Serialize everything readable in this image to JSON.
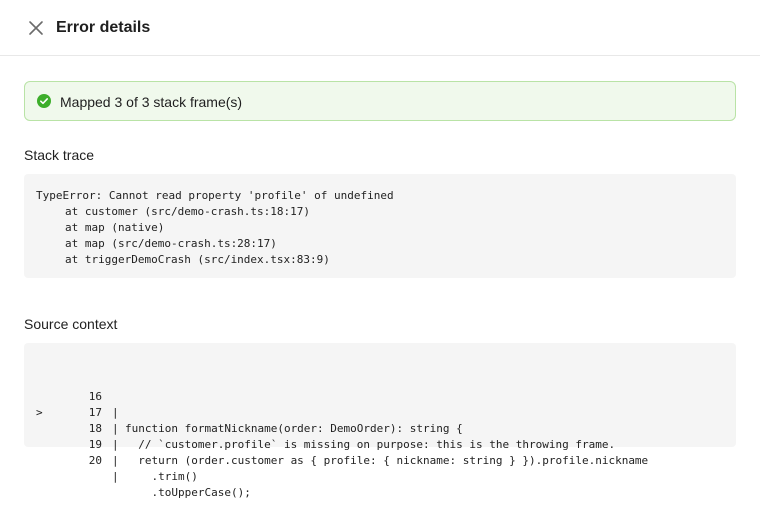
{
  "header": {
    "close_icon": "close-icon",
    "title": "Error details"
  },
  "status": {
    "icon": "check-circle-icon",
    "text": "Mapped 3 of 3 stack frame(s)",
    "colors": {
      "background": "#f0f9ec",
      "border": "#b9e3a6",
      "icon": "#3dae2b"
    }
  },
  "stack_trace": {
    "label": "Stack trace",
    "error": "TypeError: Cannot read property 'profile' of undefined",
    "frames": [
      "at customer (src/demo-crash.ts:18:17)",
      "at map (native)",
      "at map (src/demo-crash.ts:28:17)",
      "at triggerDemoCrash (src/index.tsx:83:9)"
    ]
  },
  "source_context": {
    "label": "Source context",
    "lines": [
      {
        "marker": "",
        "num": "16",
        "sep": "|",
        "code": "function formatNickname(order: DemoOrder): string {"
      },
      {
        "marker": "",
        "num": "17",
        "sep": "|",
        "code": "  // `customer.profile` is missing on purpose: this is the throwing frame."
      },
      {
        "marker": ">",
        "num": "18",
        "sep": "|",
        "code": "  return (order.customer as { profile: { nickname: string } }).profile.nickname"
      },
      {
        "marker": "",
        "num": "19",
        "sep": "|",
        "code": "    .trim()"
      },
      {
        "marker": "",
        "num": "20",
        "sep": "|",
        "code": "    .toUpperCase();"
      }
    ]
  }
}
